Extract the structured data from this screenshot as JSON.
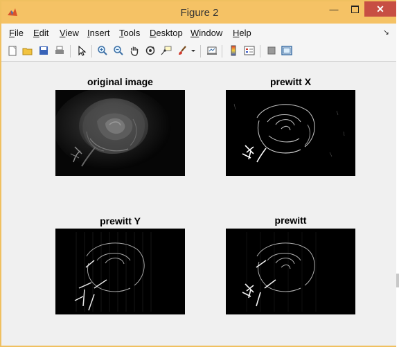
{
  "window": {
    "title": "Figure 2"
  },
  "menu": {
    "items": [
      {
        "u": "F",
        "rest": "ile"
      },
      {
        "u": "E",
        "rest": "dit"
      },
      {
        "u": "V",
        "rest": "iew"
      },
      {
        "u": "I",
        "rest": "nsert"
      },
      {
        "u": "T",
        "rest": "ools"
      },
      {
        "u": "D",
        "rest": "esktop"
      },
      {
        "u": "W",
        "rest": "indow"
      },
      {
        "u": "H",
        "rest": "elp"
      }
    ]
  },
  "toolbar": {
    "icons": [
      "new-figure-icon",
      "open-file-icon",
      "save-icon",
      "print-icon",
      "edit-plot-arrow-icon",
      "zoom-in-icon",
      "zoom-out-icon",
      "pan-hand-icon",
      "rotate-3d-icon",
      "data-cursor-icon",
      "brush-icon",
      "brush-dropdown-icon",
      "link-plot-icon",
      "insert-colorbar-icon",
      "insert-legend-icon",
      "hide-plot-tools-icon",
      "show-plot-tools-icon"
    ]
  },
  "axes": [
    {
      "title": "original image"
    },
    {
      "title": "prewitt X"
    },
    {
      "title": "prewitt Y"
    },
    {
      "title": "prewitt"
    }
  ],
  "colors": {
    "titlebar": "#f5c265",
    "close_button": "#c74e43",
    "figure_background": "#f0f0f0",
    "image_background": "#000000"
  }
}
